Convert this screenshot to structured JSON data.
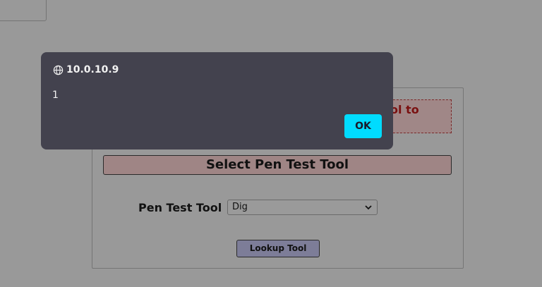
{
  "dialog": {
    "origin": "10.0.10.9",
    "message": "1",
    "ok_label": "OK",
    "icon": "globe-icon"
  },
  "panel": {
    "warning_text": "ol to",
    "section_title": "Select Pen Test Tool",
    "tool_label": "Pen Test Tool",
    "tool_selected": "Dig",
    "lookup_label": "Lookup Tool"
  },
  "colors": {
    "overlay_bg": "#999999",
    "dialog_bg": "#43424e",
    "ok_button": "#00dcff",
    "warning_text": "#7a1010",
    "header_bg": "#9f8585",
    "lookup_button": "#7d7d98"
  }
}
